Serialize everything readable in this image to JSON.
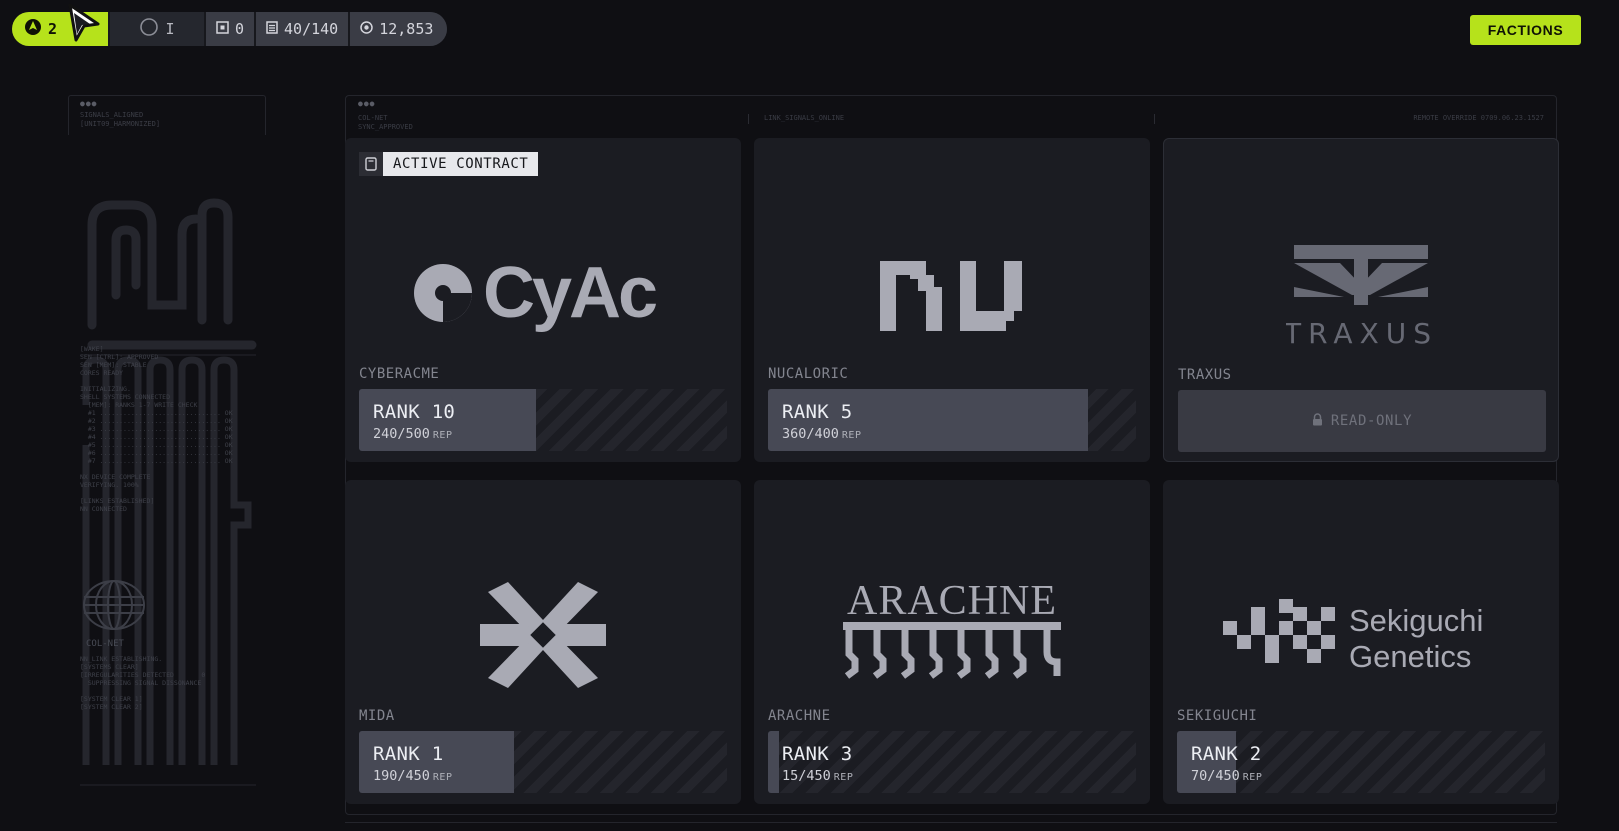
{
  "hud": {
    "level": "2",
    "prestige": "I",
    "stat_vault": "0",
    "stat_capacity": "40/140",
    "stat_credits": "12,853"
  },
  "nav": {
    "factions_label": "FACTIONS"
  },
  "left_panel": {
    "header": "SIGNALS_ALIGNED\n[UNIT09_HARMONIZED]",
    "log_1": "[WAKE]\nSEN [CTRL]: APPROVED\nSEN [MEM]: STABLE\nCORES READY\n\nINITIALIZING.\nSHELL SYSTEMS CONNECTED\n  [MEM]: RANKS 1-7 WRITE CHECK\n  #1 ............................... OK\n  #2 ............................... OK\n  #3 ............................... OK\n  #4 ............................... OK\n  #5 ............................... OK\n  #6 ............................... OK\n  #7 ............................... OK\n\nNX DEVICE COMPLETE\nVERIFYING. 100%\n\n[LINKS ESTABLISHED]\nNN CONNECTED",
    "globe_label": "COL-NET",
    "log_2": "NN_LINK ESTABLISHING.\n[SYSTEMS CLEAR]\n[IRREGULARITIES DETECTED       0\n  SUPPRESSING SIGNAL DISSONANCE\n\n[SYSTEM CLEAR 1]\n[SYSTEM CLEAR 2]"
  },
  "main_frame": {
    "label_left": "COL-NET\nSYNC_APPROVED",
    "label_mid": "LINK_SIGNALS_ONLINE",
    "label_right": "REMOTE OVERRIDE 0709.06.23.1527"
  },
  "active_contract_label": "ACTIVE CONTRACT",
  "readonly_label": "READ-ONLY",
  "factions": [
    {
      "name": "CYBERACME",
      "logo_text": "CyAc",
      "rank_label": "RANK 10",
      "rep": "240/500",
      "rep_unit": "REP",
      "progress": 0.48,
      "active_contract": true
    },
    {
      "name": "NUCALORIC",
      "rank_label": "RANK 5",
      "rep": "360/400",
      "rep_unit": "REP",
      "progress": 0.87
    },
    {
      "name": "TRAXUS",
      "logo_text": "TRAXUS",
      "locked": true
    },
    {
      "name": "MIDA",
      "rank_label": "RANK 1",
      "rep": "190/450",
      "rep_unit": "REP",
      "progress": 0.42
    },
    {
      "name": "ARACHNE",
      "logo_text": "ARACHNE",
      "rank_label": "RANK 3",
      "rep": "15/450",
      "rep_unit": "REP",
      "progress": 0.03
    },
    {
      "name": "SEKIGUCHI",
      "logo_text_1": "Sekiguchi",
      "logo_text_2": "Genetics",
      "rank_label": "RANK 2",
      "rep": "70/450",
      "rep_unit": "REP",
      "progress": 0.16
    }
  ],
  "colors": {
    "accent": "#b6e21b",
    "background": "#0f0f13",
    "card": "#1b1c22",
    "logo": "#a9aab4"
  },
  "icons": [
    "level-icon",
    "prestige-icon",
    "vault-icon",
    "capacity-icon",
    "credits-icon",
    "contract-icon",
    "lock-icon",
    "cursor-icon"
  ]
}
